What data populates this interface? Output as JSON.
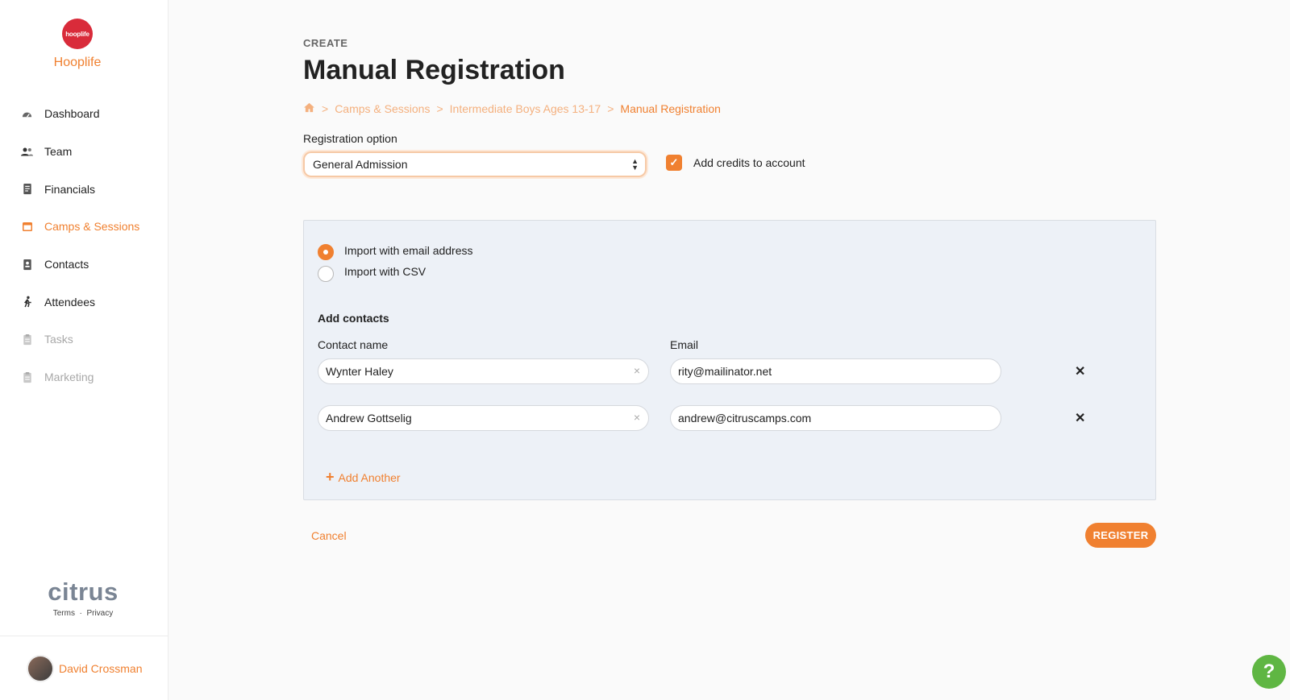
{
  "brand": {
    "logo_text": "hooplife",
    "name": "Hooplife"
  },
  "sidebar": {
    "items": [
      {
        "label": "Dashboard",
        "icon": "gauge-icon"
      },
      {
        "label": "Team",
        "icon": "people-icon"
      },
      {
        "label": "Financials",
        "icon": "document-icon"
      },
      {
        "label": "Camps & Sessions",
        "icon": "calendar-icon"
      },
      {
        "label": "Contacts",
        "icon": "address-book-icon"
      },
      {
        "label": "Attendees",
        "icon": "running-person-icon"
      },
      {
        "label": "Tasks",
        "icon": "clipboard-icon"
      },
      {
        "label": "Marketing",
        "icon": "clipboard-icon"
      }
    ],
    "footer_logo": "citrus",
    "terms": "Terms",
    "privacy": "Privacy",
    "user_name": "David Crossman"
  },
  "page": {
    "eyebrow": "CREATE",
    "title": "Manual Registration",
    "breadcrumb": [
      "Camps & Sessions",
      "Intermediate Boys Ages 13-17",
      "Manual Registration"
    ],
    "registration_option_label": "Registration option",
    "registration_option_value": "General Admission",
    "add_credits_label": "Add credits to account",
    "import_email_label": "Import with email address",
    "import_csv_label": "Import with CSV",
    "add_contacts_title": "Add contacts",
    "contact_name_label": "Contact name",
    "email_label": "Email",
    "contacts": [
      {
        "name": "Wynter Haley",
        "email": "rity@mailinator.net"
      },
      {
        "name": "Andrew Gottselig",
        "email": "andrew@citruscamps.com"
      }
    ],
    "add_another_label": "Add Another",
    "cancel_label": "Cancel",
    "register_label": "REGISTER"
  },
  "colors": {
    "accent": "#f08030",
    "help": "#5fb643",
    "panel": "#edf1f7"
  }
}
